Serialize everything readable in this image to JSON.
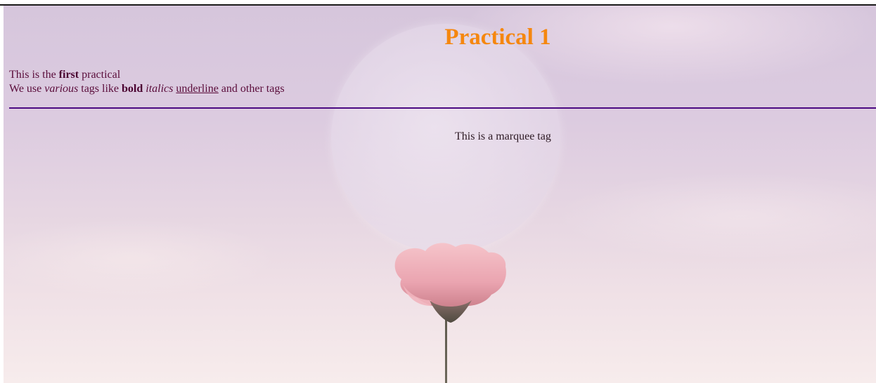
{
  "page": {
    "heading": "Practical 1",
    "line1": {
      "prefix": "This is the ",
      "bold": "first",
      "suffix": " practical"
    },
    "line2": {
      "prefix": "We use ",
      "italic": "various",
      "middle": " tags like ",
      "bold": "bold",
      "space1": " ",
      "italic2": "italics",
      "space2": " ",
      "underline": "underline",
      "suffix": " and other tags"
    },
    "marquee_text": "This is a marquee tag"
  },
  "colors": {
    "heading": "#f5870f",
    "text": "#5a0c3a",
    "rule": "#4b0a82"
  }
}
